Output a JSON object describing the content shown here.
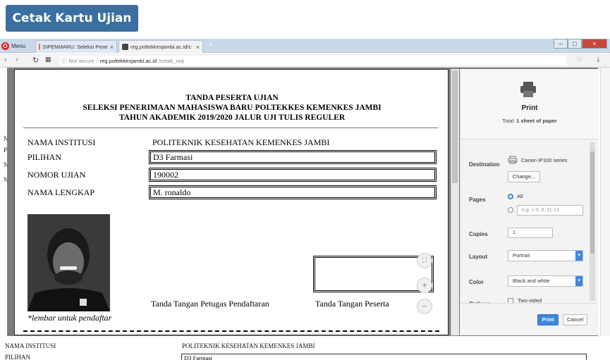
{
  "top_button": {
    "label": "Cetak Kartu Ujian"
  },
  "browser": {
    "menu_label": "Menu",
    "tabs": [
      {
        "title": "SIPENMARU: Seleksi Pene"
      },
      {
        "title": "reg.poltekkesjambi.ac.id/c"
      }
    ],
    "url_prefix": "Not secure",
    "url_host": "reg.poltekkesjambi.ac.id",
    "url_path": "/cetak_noji"
  },
  "background_page": {
    "left_letters": [
      "N",
      "PI",
      "N",
      "N"
    ],
    "bottom_form": {
      "institusi_label": "NAMA INSTITUSI",
      "institusi_value": "POLITEKNIK KESEHATAN KEMENKES JAMBI",
      "pilihan_label": "PILIHAN",
      "pilihan_value": "D3 Farmasi"
    }
  },
  "card": {
    "header": {
      "line1": "TANDA PESERTA UJIAN",
      "line2": "SELEKSI PENERIMAAN MAHASISWA BARU POLTEKKES KEMENKES JAMBI",
      "line3": "TAHUN AKADEMIK 2019/2020 JALUR UJI TULIS REGULER"
    },
    "fields": {
      "institusi_label": "NAMA INSTITUSI",
      "institusi_value": "POLITEKNIK KESEHATAN KEMENKES JAMBI",
      "pilihan_label": "PILIHAN",
      "pilihan_value": "D3 Farmasi",
      "nomor_label": "NOMOR UJIAN",
      "nomor_value": "190002",
      "nama_label": "NAMA LENGKAP",
      "nama_value": "M. ronaldo"
    },
    "sign_petugas": "Tanda Tangan Petugas Pendaftaran",
    "sign_peserta": "Tanda Tangan Peserta",
    "footnote": "*lembar untuk pendaftar"
  },
  "print_panel": {
    "title": "Print",
    "total_prefix": "Total:",
    "total_value": "1 sheet of paper",
    "destination_label": "Destination",
    "printer_name": "Canon iP100 series",
    "change_label": "Change...",
    "pages_label": "Pages",
    "pages_all": "All",
    "pages_placeholder": "e.g. 1-5, 8, 11-13",
    "copies_label": "Copies",
    "copies_value": "1",
    "layout_label": "Layout",
    "layout_value": "Portrait",
    "color_label": "Color",
    "color_value": "Black and white",
    "options_label": "Options",
    "two_sided": "Two-sided",
    "print_btn": "Print",
    "cancel_btn": "Cancel"
  }
}
